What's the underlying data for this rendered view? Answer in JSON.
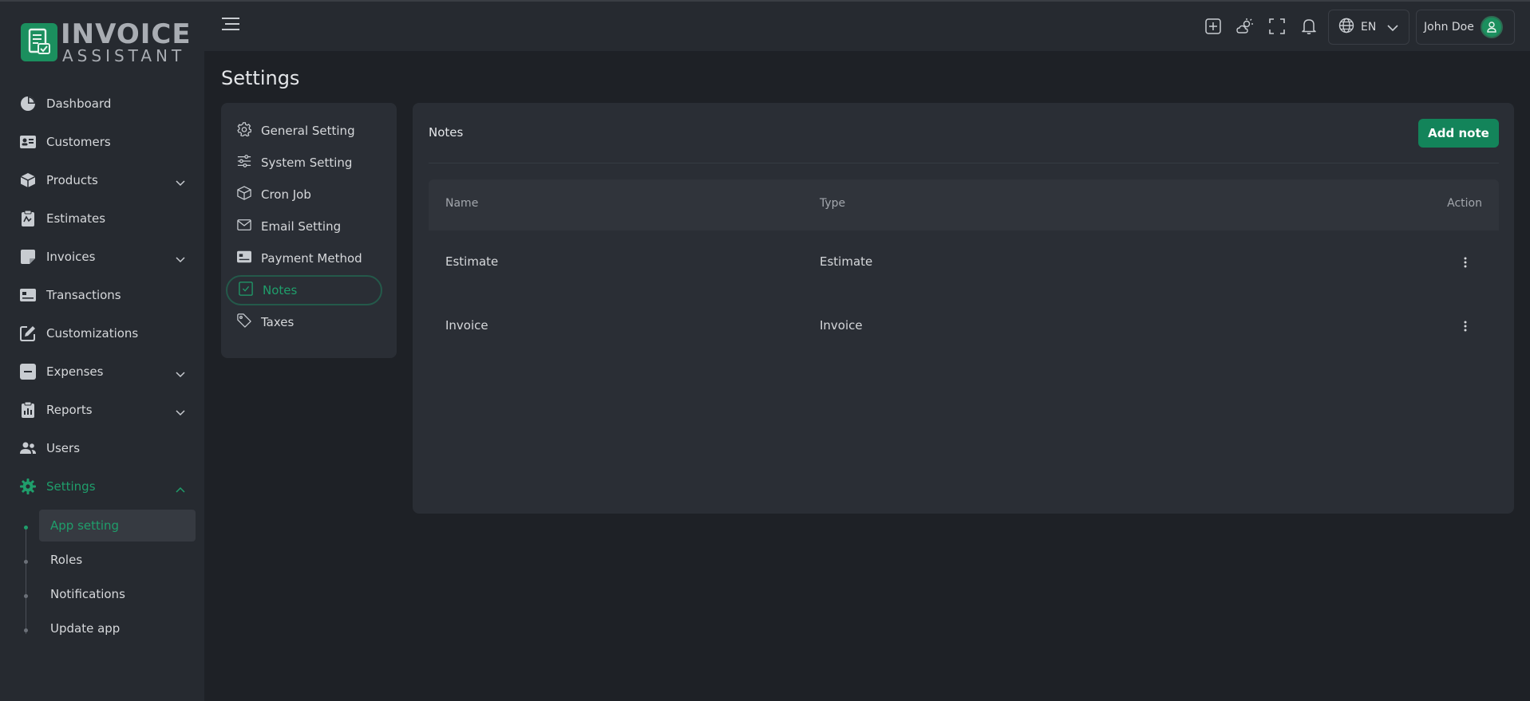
{
  "brand": {
    "line1": "INVOICE",
    "line2": "ASSISTANT",
    "accent": "#1b8f5e"
  },
  "sidebar": {
    "items": [
      {
        "label": "Dashboard",
        "icon": "pie-chart-icon"
      },
      {
        "label": "Customers",
        "icon": "id-card-icon"
      },
      {
        "label": "Products",
        "icon": "box-icon",
        "expandable": true
      },
      {
        "label": "Estimates",
        "icon": "clipboard-icon"
      },
      {
        "label": "Invoices",
        "icon": "invoice-icon",
        "expandable": true
      },
      {
        "label": "Transactions",
        "icon": "card-icon"
      },
      {
        "label": "Customizations",
        "icon": "edit-icon"
      },
      {
        "label": "Expenses",
        "icon": "minus-box-icon",
        "expandable": true
      },
      {
        "label": "Reports",
        "icon": "report-icon",
        "expandable": true
      },
      {
        "label": "Users",
        "icon": "users-icon"
      },
      {
        "label": "Settings",
        "icon": "gear-icon",
        "expandable": true,
        "active": true
      }
    ],
    "sub_items": [
      {
        "label": "App setting",
        "active": true
      },
      {
        "label": "Roles"
      },
      {
        "label": "Notifications"
      },
      {
        "label": "Update app"
      }
    ]
  },
  "topbar": {
    "language": "EN",
    "user_name": "John Doe"
  },
  "page": {
    "title": "Settings"
  },
  "settings_menu": [
    {
      "label": "General Setting",
      "icon": "gear-icon"
    },
    {
      "label": "System Setting",
      "icon": "sliders-icon"
    },
    {
      "label": "Cron Job",
      "icon": "cube-icon"
    },
    {
      "label": "Email Setting",
      "icon": "envelope-icon"
    },
    {
      "label": "Payment Method",
      "icon": "payment-icon"
    },
    {
      "label": "Notes",
      "icon": "note-check-icon",
      "active": true
    },
    {
      "label": "Taxes",
      "icon": "tag-icon"
    }
  ],
  "notes": {
    "title": "Notes",
    "add_label": "Add note",
    "columns": {
      "name": "Name",
      "type": "Type",
      "action": "Action"
    },
    "rows": [
      {
        "name": "Estimate",
        "type": "Estimate"
      },
      {
        "name": "Invoice",
        "type": "Invoice"
      }
    ]
  }
}
